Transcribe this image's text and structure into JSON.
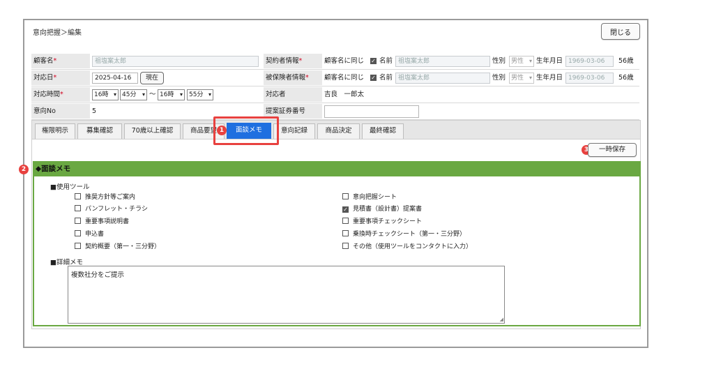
{
  "breadcrumb": "意向把握＞編集",
  "close_label": "閉じる",
  "fields": {
    "customer_name_label": "顧客名",
    "customer_name_value": "祖塩案太郎",
    "contact_date_label": "対応日",
    "contact_date_value": "2025-04-16",
    "now_button": "現在",
    "contact_time_label": "対応時間",
    "time_start_hour": "16時",
    "time_start_min": "45分",
    "time_sep": "～",
    "time_end_hour": "16時",
    "time_end_min": "55分",
    "intent_no_label": "意向No",
    "intent_no_value": "5",
    "contractor_label": "契約者情報",
    "insured_label": "被保険者情報",
    "same_as_customer": "顧客名に同じ",
    "name_label": "名前",
    "person_name_value": "祖塩案太郎",
    "gender_label": "性別",
    "gender_value": "男性",
    "birthdate_label": "生年月日",
    "birthdate_value": "1969-03-06",
    "age_value": "56歳",
    "handler_label": "対応者",
    "handler_value": "吉良　一郎太",
    "proposal_no_label": "提案証券番号",
    "proposal_no_value": ""
  },
  "tabs": [
    {
      "label": "権限明示"
    },
    {
      "label": "募集確認"
    },
    {
      "label": "70歳以上確認"
    },
    {
      "label": "商品要望"
    },
    {
      "label": "面談メモ"
    },
    {
      "label": "意向記録"
    },
    {
      "label": "商品決定"
    },
    {
      "label": "最終確認"
    }
  ],
  "active_tab": "面談メモ",
  "badges": {
    "one": "1",
    "two": "2",
    "three": "3"
  },
  "save_label": "一時保存",
  "section_title": "◆面談メモ",
  "tools_heading": "■使用ツール",
  "tools_left": [
    {
      "label": "推奨方針等ご案内",
      "checked": false
    },
    {
      "label": "パンフレット・チラシ",
      "checked": false
    },
    {
      "label": "重要事項説明書",
      "checked": false
    },
    {
      "label": "申込書",
      "checked": false
    },
    {
      "label": "契約概要（第一・三分野）",
      "checked": false
    }
  ],
  "tools_right": [
    {
      "label": "意向把握シート",
      "checked": false
    },
    {
      "label": "見積書（設計書）提案書",
      "checked": true
    },
    {
      "label": "重要事項チェックシート",
      "checked": false
    },
    {
      "label": "乗換時チェックシート（第一・三分野）",
      "checked": false
    },
    {
      "label": "その他（使用ツールをコンタクトに入力）",
      "checked": false
    }
  ],
  "memo_heading": "■詳細メモ",
  "memo_text": "複数社分をご提示",
  "colors": {
    "accent": "#1f6fe0",
    "section": "#6aa842",
    "annotation": "#e8413f",
    "required": "#d0001e"
  }
}
